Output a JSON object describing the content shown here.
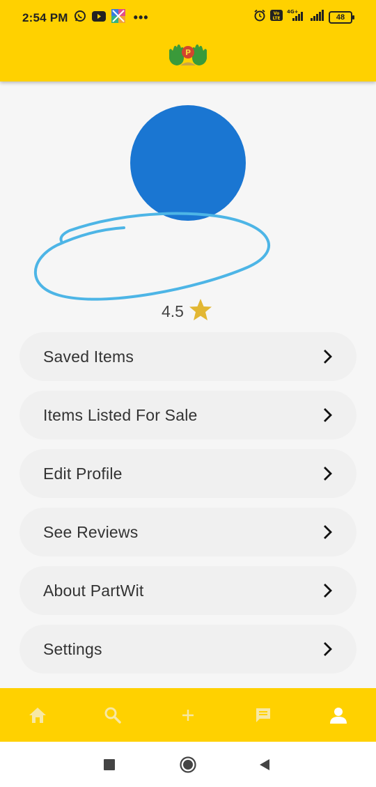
{
  "status_bar": {
    "time": "2:54 PM",
    "battery": "48",
    "network": "4G+",
    "volte": "Vo LTE",
    "left_icons": [
      "whatsapp-icon",
      "youtube-icon",
      "app-icon",
      "more-dots-icon"
    ],
    "right_icons": [
      "alarm-icon",
      "volte-icon",
      "signal-icon",
      "signal-icon",
      "battery-icon"
    ]
  },
  "app_bar": {
    "logo_icon": "partwit-hands-logo"
  },
  "profile": {
    "avatar_color": "#1a76d2",
    "rating": "4.5",
    "rating_icon": "star-icon",
    "star_color": "#e2b733"
  },
  "menu": {
    "items": [
      {
        "label": "Saved Items"
      },
      {
        "label": "Items Listed For Sale"
      },
      {
        "label": "Edit Profile"
      },
      {
        "label": "See Reviews"
      },
      {
        "label": "About PartWit"
      },
      {
        "label": "Settings"
      }
    ]
  },
  "bottom_nav": {
    "items": [
      "home-icon",
      "search-icon",
      "add-icon",
      "chat-icon",
      "profile-icon"
    ],
    "active": "profile-icon"
  },
  "system_nav": [
    "recents-icon",
    "home-icon",
    "back-icon"
  ],
  "colors": {
    "accent": "#ffd100",
    "scribble": "#4db5e6"
  }
}
